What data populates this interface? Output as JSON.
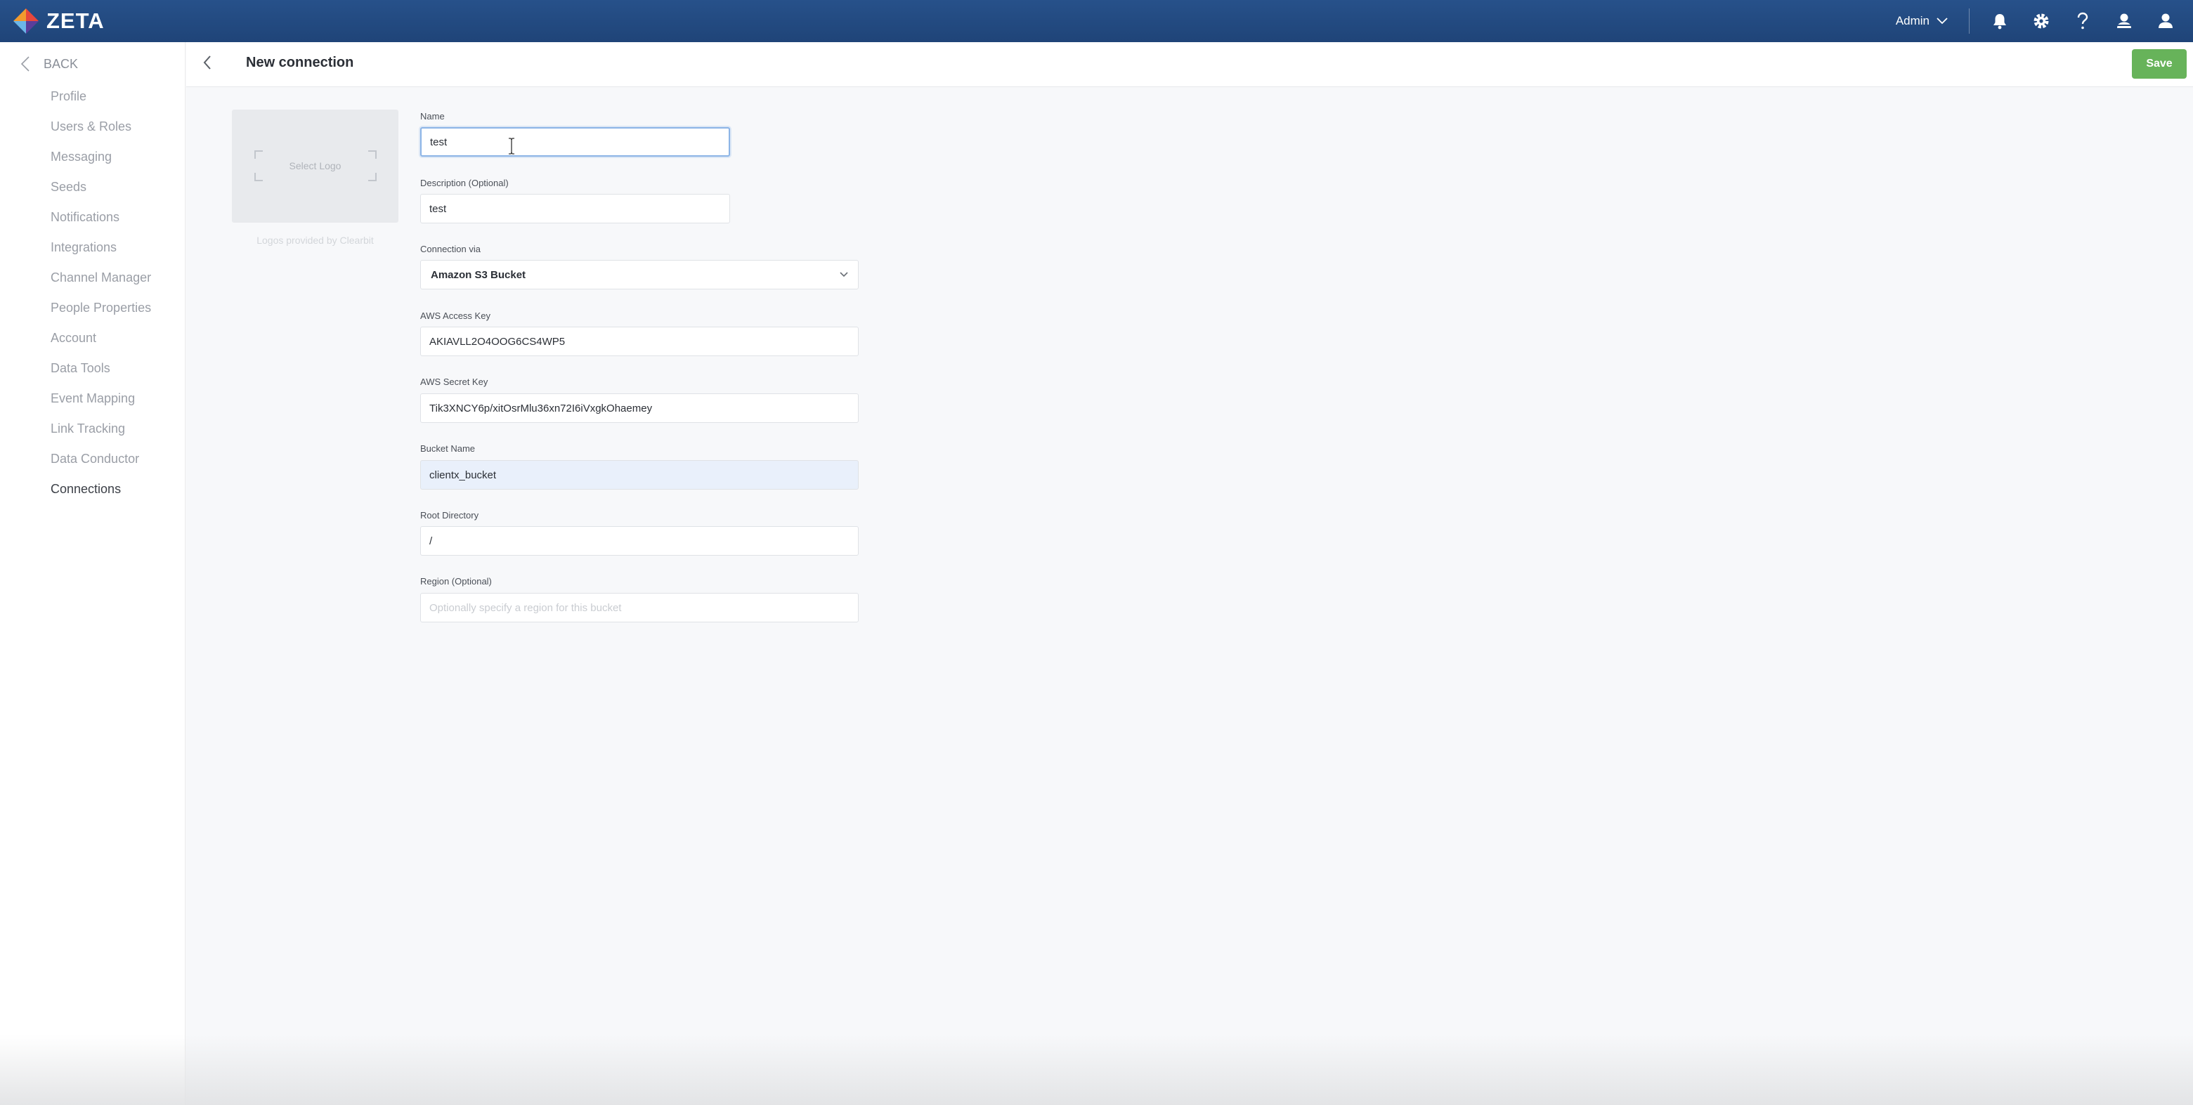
{
  "app": {
    "brand": "ZETA",
    "accent": "#234b82",
    "success": "#67b35a"
  },
  "topbar": {
    "user_menu_label": "Admin",
    "icons": [
      "bell-icon",
      "gear-icon",
      "help-icon",
      "user-switch-icon",
      "user-icon"
    ]
  },
  "sidebar": {
    "back_label": "BACK",
    "items": [
      {
        "label": "Profile"
      },
      {
        "label": "Users & Roles"
      },
      {
        "label": "Messaging"
      },
      {
        "label": "Seeds"
      },
      {
        "label": "Notifications"
      },
      {
        "label": "Integrations"
      },
      {
        "label": "Channel Manager"
      },
      {
        "label": "People Properties"
      },
      {
        "label": "Account"
      },
      {
        "label": "Data Tools"
      },
      {
        "label": "Event Mapping"
      },
      {
        "label": "Link Tracking"
      },
      {
        "label": "Data Conductor"
      },
      {
        "label": "Connections",
        "active": true
      }
    ]
  },
  "header": {
    "title": "New connection",
    "save_label": "Save"
  },
  "logo_picker": {
    "label": "Select Logo",
    "caption": "Logos provided by Clearbit"
  },
  "form": {
    "name": {
      "label": "Name",
      "value": "test"
    },
    "description": {
      "label": "Description (Optional)",
      "value": "test"
    },
    "connection_via": {
      "label": "Connection via",
      "value": "Amazon S3 Bucket"
    },
    "aws_access_key": {
      "label": "AWS Access Key",
      "value": "AKIAVLL2O4OOG6CS4WP5"
    },
    "aws_secret_key": {
      "label": "AWS Secret Key",
      "value": "Tik3XNCY6p/xitOsrMlu36xn72I6iVxgkOhaemey"
    },
    "bucket_name": {
      "label": "Bucket Name",
      "value": "clientx_bucket"
    },
    "root_directory": {
      "label": "Root Directory",
      "value": "/"
    },
    "region": {
      "label": "Region (Optional)",
      "value": "",
      "placeholder": "Optionally specify a region for this bucket"
    }
  }
}
